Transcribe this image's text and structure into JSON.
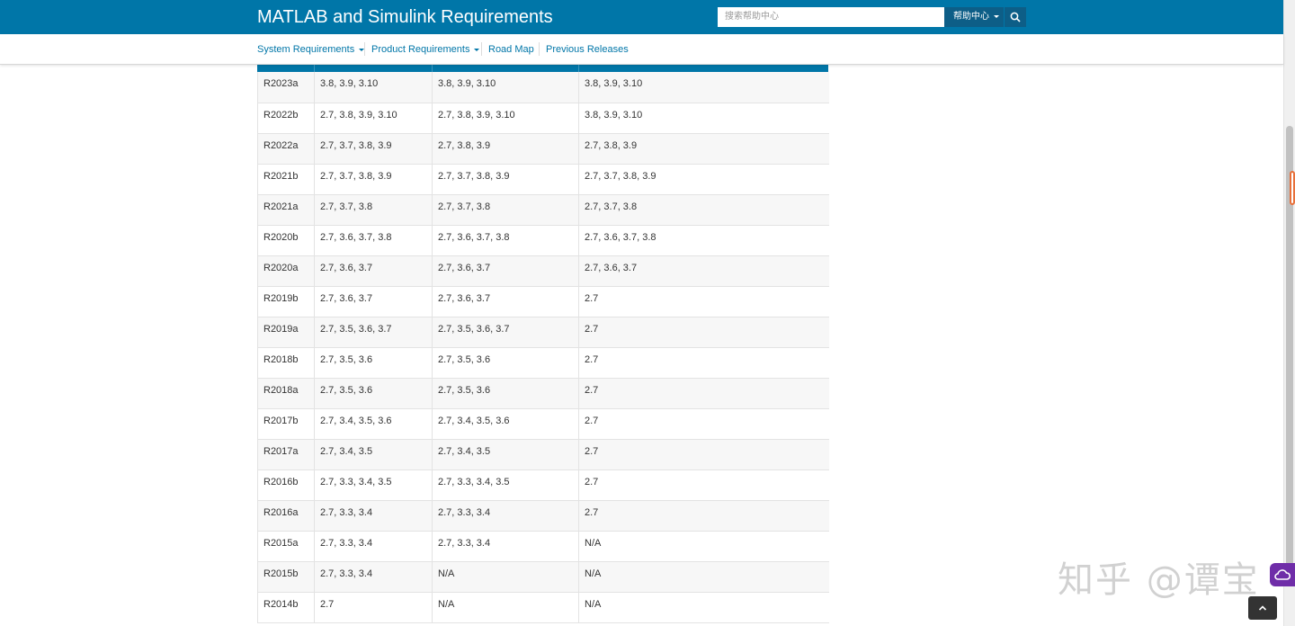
{
  "header": {
    "title": "MATLAB and Simulink Requirements",
    "search_placeholder": "搜索帮助中心",
    "search_scope": "帮助中心"
  },
  "nav": {
    "items": [
      {
        "label": "System Requirements",
        "dropdown": true
      },
      {
        "label": "Product Requirements",
        "dropdown": true
      },
      {
        "label": "Road Map",
        "dropdown": false
      },
      {
        "label": "Previous Releases",
        "dropdown": false
      }
    ]
  },
  "table": {
    "rows": [
      [
        "R2023a",
        "3.8, 3.9, 3.10",
        "3.8, 3.9, 3.10",
        "3.8, 3.9, 3.10"
      ],
      [
        "R2022b",
        "2.7, 3.8, 3.9, 3.10",
        "2.7, 3.8, 3.9, 3.10",
        "3.8, 3.9, 3.10"
      ],
      [
        "R2022a",
        "2.7, 3.7, 3.8, 3.9",
        "2.7, 3.8, 3.9",
        "2.7, 3.8, 3.9"
      ],
      [
        "R2021b",
        "2.7, 3.7, 3.8, 3.9",
        "2.7, 3.7, 3.8, 3.9",
        "2.7, 3.7, 3.8, 3.9"
      ],
      [
        "R2021a",
        "2.7, 3.7, 3.8",
        "2.7, 3.7, 3.8",
        "2.7, 3.7, 3.8"
      ],
      [
        "R2020b",
        "2.7, 3.6, 3.7, 3.8",
        "2.7, 3.6, 3.7, 3.8",
        "2.7, 3.6, 3.7, 3.8"
      ],
      [
        "R2020a",
        "2.7, 3.6, 3.7",
        "2.7, 3.6, 3.7",
        "2.7, 3.6, 3.7"
      ],
      [
        "R2019b",
        "2.7, 3.6, 3.7",
        "2.7, 3.6, 3.7",
        "2.7"
      ],
      [
        "R2019a",
        "2.7, 3.5, 3.6, 3.7",
        "2.7, 3.5, 3.6, 3.7",
        "2.7"
      ],
      [
        "R2018b",
        "2.7, 3.5, 3.6",
        "2.7, 3.5, 3.6",
        "2.7"
      ],
      [
        "R2018a",
        "2.7, 3.5, 3.6",
        "2.7, 3.5, 3.6",
        "2.7"
      ],
      [
        "R2017b",
        "2.7, 3.4, 3.5, 3.6",
        "2.7, 3.4, 3.5, 3.6",
        "2.7"
      ],
      [
        "R2017a",
        "2.7, 3.4, 3.5",
        "2.7, 3.4, 3.5",
        "2.7"
      ],
      [
        "R2016b",
        "2.7, 3.3, 3.4, 3.5",
        "2.7, 3.3, 3.4, 3.5",
        "2.7"
      ],
      [
        "R2016a",
        "2.7, 3.3, 3.4",
        "2.7, 3.3, 3.4",
        "2.7"
      ],
      [
        "R2015a",
        "2.7, 3.3, 3.4",
        "2.7, 3.3, 3.4",
        "N/A"
      ],
      [
        "R2015b",
        "2.7, 3.3, 3.4",
        "N/A",
        "N/A"
      ],
      [
        "R2014b",
        "2.7",
        "N/A",
        "N/A"
      ]
    ]
  },
  "watermark": "知乎 @谭宝",
  "icons": {
    "search": "search-icon",
    "back_to_top": "chevron-up-icon",
    "cloud": "cloud-icon"
  },
  "colors": {
    "brand": "#0076a8",
    "link": "#0076a8"
  }
}
